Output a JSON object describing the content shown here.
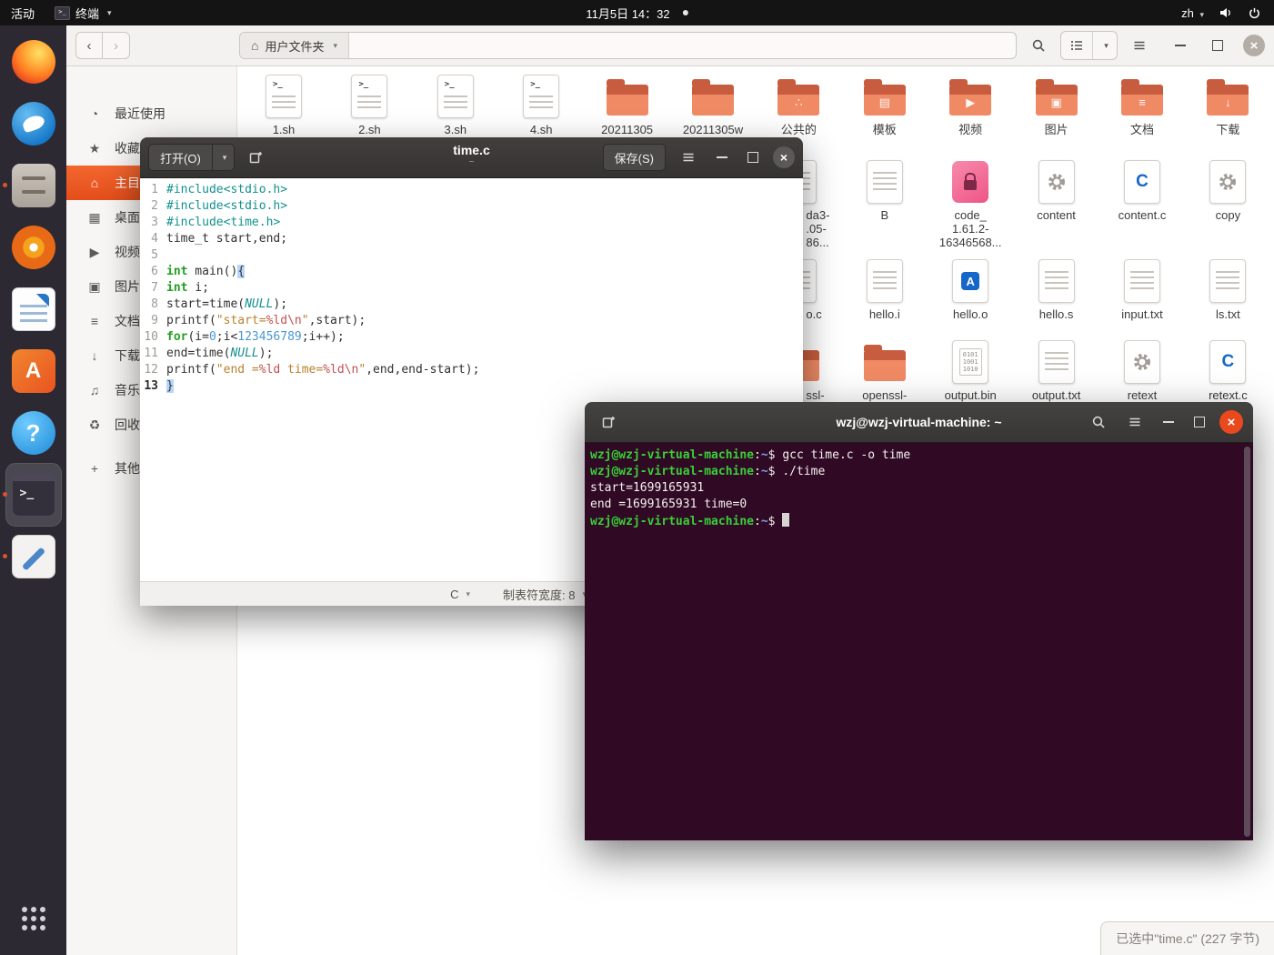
{
  "colors": {
    "accent": "#e95420",
    "terminal_bg": "#300a24",
    "prompt_green": "#38d038",
    "path_blue": "#7aa7dc",
    "selected_sidebar": "#e95420"
  },
  "topbar": {
    "activities": "活动",
    "app_name": "终端",
    "clock": "11月5日 14：32",
    "lang": "zh"
  },
  "dock": {
    "items": [
      {
        "name": "firefox",
        "running": false,
        "active": false
      },
      {
        "name": "thunderbird",
        "running": false,
        "active": false
      },
      {
        "name": "files",
        "running": true,
        "active": false
      },
      {
        "name": "rhythmbox",
        "running": false,
        "active": false
      },
      {
        "name": "libreoffice-writer",
        "running": false,
        "active": false
      },
      {
        "name": "ubuntu-software",
        "running": false,
        "active": false
      },
      {
        "name": "help",
        "running": false,
        "active": false
      },
      {
        "name": "terminal",
        "running": true,
        "active": true
      },
      {
        "name": "gedit",
        "running": true,
        "active": false
      },
      {
        "name": "show-apps",
        "running": false,
        "active": false,
        "bottom": true
      }
    ]
  },
  "files": {
    "path_label": "用户文件夹",
    "sidebar": [
      {
        "label": "最近使用",
        "icon": "recent"
      },
      {
        "label": "收藏",
        "icon": "starred"
      },
      {
        "label": "主目录",
        "icon": "home",
        "selected": true
      },
      {
        "label": "桌面",
        "icon": "desktop"
      },
      {
        "label": "视频",
        "icon": "videos"
      },
      {
        "label": "图片",
        "icon": "pictures"
      },
      {
        "label": "文档",
        "icon": "documents"
      },
      {
        "label": "下载",
        "icon": "downloads"
      },
      {
        "label": "音乐",
        "icon": "music"
      },
      {
        "label": "回收站",
        "icon": "trash"
      },
      {
        "label": "其他位置",
        "icon": "other",
        "separated": true
      }
    ],
    "grid": [
      {
        "row": 0,
        "col": 0,
        "label": "1.sh",
        "icon": "script"
      },
      {
        "row": 0,
        "col": 1,
        "label": "2.sh",
        "icon": "script"
      },
      {
        "row": 0,
        "col": 2,
        "label": "3.sh",
        "icon": "script"
      },
      {
        "row": 0,
        "col": 3,
        "label": "4.sh",
        "icon": "script"
      },
      {
        "row": 0,
        "col": 4,
        "label": "20211305",
        "icon": "folder"
      },
      {
        "row": 0,
        "col": 5,
        "label": "20211305w",
        "icon": "folder"
      },
      {
        "row": 0,
        "col": 6,
        "label": "公共的",
        "icon": "folder-public"
      },
      {
        "row": 0,
        "col": 7,
        "label": "模板",
        "icon": "folder-templates"
      },
      {
        "row": 0,
        "col": 8,
        "label": "视频",
        "icon": "folder-videos"
      },
      {
        "row": 0,
        "col": 9,
        "label": "图片",
        "icon": "folder-pictures"
      },
      {
        "row": 0,
        "col": 10,
        "label": "文档",
        "icon": "folder-documents"
      },
      {
        "row": 0,
        "col": 11,
        "label": "下载",
        "icon": "folder-download"
      },
      {
        "row": 1,
        "col": 6,
        "label": "da3-\n.05-\n86...",
        "icon": "text",
        "partial": true
      },
      {
        "row": 1,
        "col": 7,
        "label": "B",
        "icon": "text"
      },
      {
        "row": 1,
        "col": 8,
        "label": "code_\n1.61.2-\n16346568...",
        "icon": "package-lock"
      },
      {
        "row": 1,
        "col": 9,
        "label": "content",
        "icon": "executable"
      },
      {
        "row": 1,
        "col": 10,
        "label": "content.c",
        "icon": "c-source"
      },
      {
        "row": 1,
        "col": 11,
        "label": "copy",
        "icon": "executable"
      },
      {
        "row": 2,
        "col": 6,
        "label": "o.c",
        "icon": "text",
        "partial": true
      },
      {
        "row": 2,
        "col": 7,
        "label": "hello.i",
        "icon": "text"
      },
      {
        "row": 2,
        "col": 8,
        "label": "hello.o",
        "icon": "object"
      },
      {
        "row": 2,
        "col": 9,
        "label": "hello.s",
        "icon": "text"
      },
      {
        "row": 2,
        "col": 10,
        "label": "input.txt",
        "icon": "text"
      },
      {
        "row": 2,
        "col": 11,
        "label": "ls.txt",
        "icon": "text"
      },
      {
        "row": 3,
        "col": 6,
        "label": "ssl-",
        "icon": "folder",
        "partial": true
      },
      {
        "row": 3,
        "col": 7,
        "label": "openssl-",
        "icon": "folder"
      },
      {
        "row": 3,
        "col": 8,
        "label": "output.bin",
        "icon": "binary"
      },
      {
        "row": 3,
        "col": 9,
        "label": "output.txt",
        "icon": "text"
      },
      {
        "row": 3,
        "col": 10,
        "label": "retext",
        "icon": "executable"
      },
      {
        "row": 3,
        "col": 11,
        "label": "retext.c",
        "icon": "c-source"
      }
    ],
    "status": "已选中\"time.c\" (227 字节)"
  },
  "editor": {
    "open_label": "打开(O)",
    "save_label": "保存(S)",
    "title": "time.c",
    "subtitle": "~",
    "status": {
      "language": "C",
      "tab_width": "制表符宽度: 8"
    },
    "code": [
      [
        {
          "t": "#include<stdio.h>",
          "c": "pp"
        }
      ],
      [
        {
          "t": "#include<stdio.h>",
          "c": "pp"
        }
      ],
      [
        {
          "t": "#include<time.h>",
          "c": "pp"
        }
      ],
      [
        {
          "t": "time_t start,end;",
          "c": ""
        }
      ],
      [],
      [
        {
          "t": "int",
          "c": "kw"
        },
        {
          "t": " main()",
          "c": ""
        },
        {
          "t": "{",
          "c": "match"
        }
      ],
      [
        {
          "t": "int",
          "c": "kw"
        },
        {
          "t": " i;",
          "c": ""
        }
      ],
      [
        {
          "t": "start=time(",
          "c": ""
        },
        {
          "t": "NULL",
          "c": "nul"
        },
        {
          "t": ");",
          "c": ""
        }
      ],
      [
        {
          "t": "printf(",
          "c": ""
        },
        {
          "t": "\"start=",
          "c": "str"
        },
        {
          "t": "%ld",
          "c": "fmt"
        },
        {
          "t": "\\n",
          "c": "esc"
        },
        {
          "t": "\"",
          "c": "str"
        },
        {
          "t": ",start);",
          "c": ""
        }
      ],
      [
        {
          "t": "for",
          "c": "kw"
        },
        {
          "t": "(i=",
          "c": ""
        },
        {
          "t": "0",
          "c": "num"
        },
        {
          "t": ";i<",
          "c": ""
        },
        {
          "t": "123456789",
          "c": "num"
        },
        {
          "t": ";i++);",
          "c": ""
        }
      ],
      [
        {
          "t": "end=time(",
          "c": ""
        },
        {
          "t": "NULL",
          "c": "nul"
        },
        {
          "t": ");",
          "c": ""
        }
      ],
      [
        {
          "t": "printf(",
          "c": ""
        },
        {
          "t": "\"end =",
          "c": "str"
        },
        {
          "t": "%ld",
          "c": "fmt"
        },
        {
          "t": " time=",
          "c": "str"
        },
        {
          "t": "%ld",
          "c": "fmt"
        },
        {
          "t": "\\n",
          "c": "esc"
        },
        {
          "t": "\"",
          "c": "str"
        },
        {
          "t": ",end,end-start);",
          "c": ""
        }
      ],
      [
        {
          "t": "}",
          "c": "match"
        }
      ]
    ]
  },
  "terminal": {
    "title": "wzj@wzj-virtual-machine: ~",
    "prompt": {
      "user": "wzj@wzj-virtual-machine",
      "colon": ":",
      "path": "~",
      "dollar": "$"
    },
    "lines": [
      {
        "prompt": true,
        "text": "gcc time.c -o time"
      },
      {
        "prompt": true,
        "text": "./time"
      },
      {
        "prompt": false,
        "text": "start=1699165931"
      },
      {
        "prompt": false,
        "text": "end =1699165931 time=0"
      },
      {
        "prompt": true,
        "text": "",
        "cursor": true
      }
    ]
  }
}
